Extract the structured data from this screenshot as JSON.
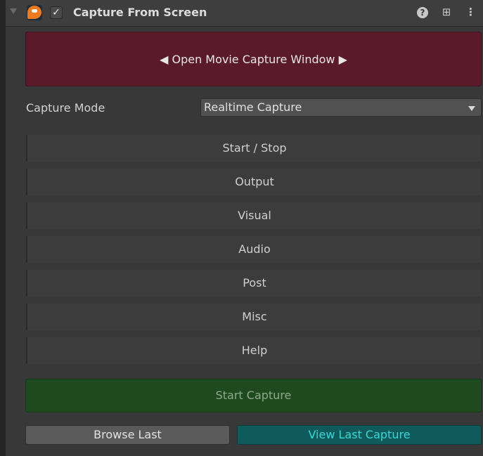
{
  "header": {
    "title": "Capture From Screen",
    "enabled": true,
    "checkbox_glyph": "✓",
    "help_glyph": "?",
    "preset_glyph": "⊞",
    "menu_glyph": "⋮",
    "icons": [
      "foldout-icon",
      "movie-capture-logo-icon",
      "help-icon",
      "preset-icon",
      "context-menu-icon"
    ]
  },
  "open_window": {
    "label": "◀ Open Movie Capture Window ▶",
    "color": "#5a1a2a"
  },
  "capture_mode": {
    "label": "Capture Mode",
    "value": "Realtime Capture"
  },
  "sections": [
    {
      "label": "Start / Stop"
    },
    {
      "label": "Output"
    },
    {
      "label": "Visual"
    },
    {
      "label": "Audio"
    },
    {
      "label": "Post"
    },
    {
      "label": "Misc"
    },
    {
      "label": "Help"
    }
  ],
  "actions": {
    "start_capture": "Start Capture",
    "browse_last": "Browse Last",
    "view_last_capture": "View Last Capture"
  },
  "colors": {
    "start_capture": "#1f4a1f",
    "view_last_capture": "#0f5a5a",
    "view_last_capture_text": "#36d8d8"
  }
}
